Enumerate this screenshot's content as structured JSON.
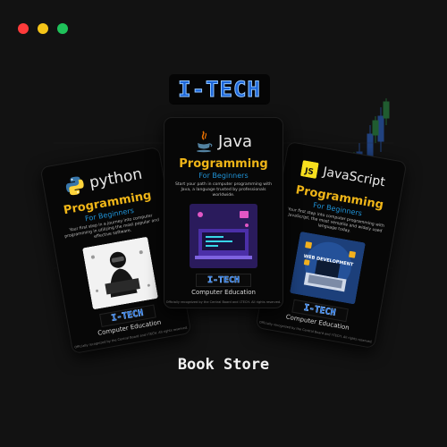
{
  "window": {
    "controls": [
      {
        "name": "close",
        "color": "#ff3b3b"
      },
      {
        "name": "minimize",
        "color": "#f5c518"
      },
      {
        "name": "maximize",
        "color": "#1fc25a"
      }
    ]
  },
  "brand": {
    "logo_text": "I-TECH",
    "color": "#1c66d8"
  },
  "books": [
    {
      "language": "python",
      "icon": "python-logo-icon",
      "subject": "Programming",
      "level": "For Beginners",
      "description": "Your first step in a journey into computer programming in utilizing the most popular and effective software.",
      "badge": "I-TECH",
      "footer_label": "Computer Education",
      "fine_print": "Officially recognized by the Central Board and I-TECH. All rights reserved."
    },
    {
      "language": "Java",
      "icon": "java-coffee-cup-icon",
      "subject": "Programming",
      "level": "For Beginners",
      "description": "Start your path in computer programming with Java, a language trusted by professionals worldwide.",
      "badge": "I-TECH",
      "footer_label": "Computer Education",
      "fine_print": "Officially recognized by the Central Board and I-TECH. All rights reserved."
    },
    {
      "language": "JavaScript",
      "icon": "js-badge-icon",
      "subject": "Programming",
      "level": "For Beginners",
      "description": "Your first step into computer programming with JavaScript, the most versatile and widely used language today.",
      "art_caption": "WEB DEVELOPMENT",
      "badge": "I-TECH",
      "footer_label": "Computer Education",
      "fine_print": "Officially recognized by the Central Board and I-TECH. All rights reserved."
    }
  ],
  "store": {
    "title": "Book Store"
  }
}
